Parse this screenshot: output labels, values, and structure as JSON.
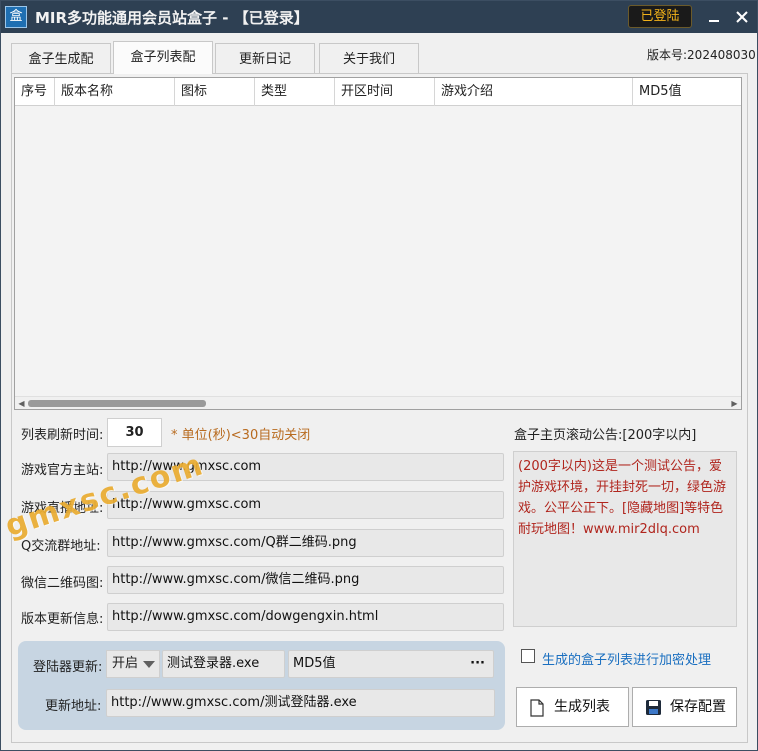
{
  "window": {
    "app_icon": "盒",
    "title": "MIR多功能通用会员站盒子 - 【已登录】",
    "login_badge": "已登陆",
    "minimize_icon": "minimize-icon",
    "close_icon": "close-icon",
    "version": "版本号:202408030"
  },
  "tabs": [
    {
      "label": "盒子生成配",
      "active": false
    },
    {
      "label": "盒子列表配",
      "active": true
    },
    {
      "label": "更新日记",
      "active": false
    },
    {
      "label": "关于我们",
      "active": false
    }
  ],
  "grid": {
    "columns": [
      "序号",
      "版本名称",
      "图标",
      "类型",
      "开区时间",
      "游戏介绍",
      "MD5值"
    ],
    "rows": []
  },
  "form": {
    "refresh_label": "列表刷新时间:",
    "refresh_value": "30",
    "refresh_hint": "* 单位(秒)<30自动关闭",
    "official_site_label": "游戏官方主站:",
    "official_site_value": "http://www.gmxsc.com",
    "live_label": "游戏直播地址:",
    "live_value": "http://www.gmxsc.com",
    "qq_group_label": "Q交流群地址:",
    "qq_group_value": "http://www.gmxsc.com/Q群二维码.png",
    "wechat_label": "微信二维码图:",
    "wechat_value": "http://www.gmxsc.com/微信二维码.png",
    "update_info_label": "版本更新信息:",
    "update_info_value": "http://www.gmxsc.com/dowgengxin.html"
  },
  "notice": {
    "label": "盒子主页滚动公告:[200字以内]",
    "text": "(200字以内)这是一个测试公告，爱护游戏环境，开挂封死一切，绿色游戏。公平公正下。[隐藏地图]等特色耐玩地图！www.mir2dlq.com"
  },
  "updater": {
    "label": "登陆器更新:",
    "state": "开启",
    "file": "测试登录器.exe",
    "md5": "MD5值",
    "md5_more": "···",
    "url_label": "更新地址:",
    "url_value": "http://www.gmxsc.com/测试登陆器.exe"
  },
  "encrypt": {
    "label": "生成的盒子列表进行加密处理",
    "checked": false
  },
  "buttons": {
    "generate": "生成列表",
    "generate_icon": "document-icon",
    "save": "保存配置",
    "save_icon": "floppy-disk-icon"
  },
  "watermark": "gmxsc.com"
}
